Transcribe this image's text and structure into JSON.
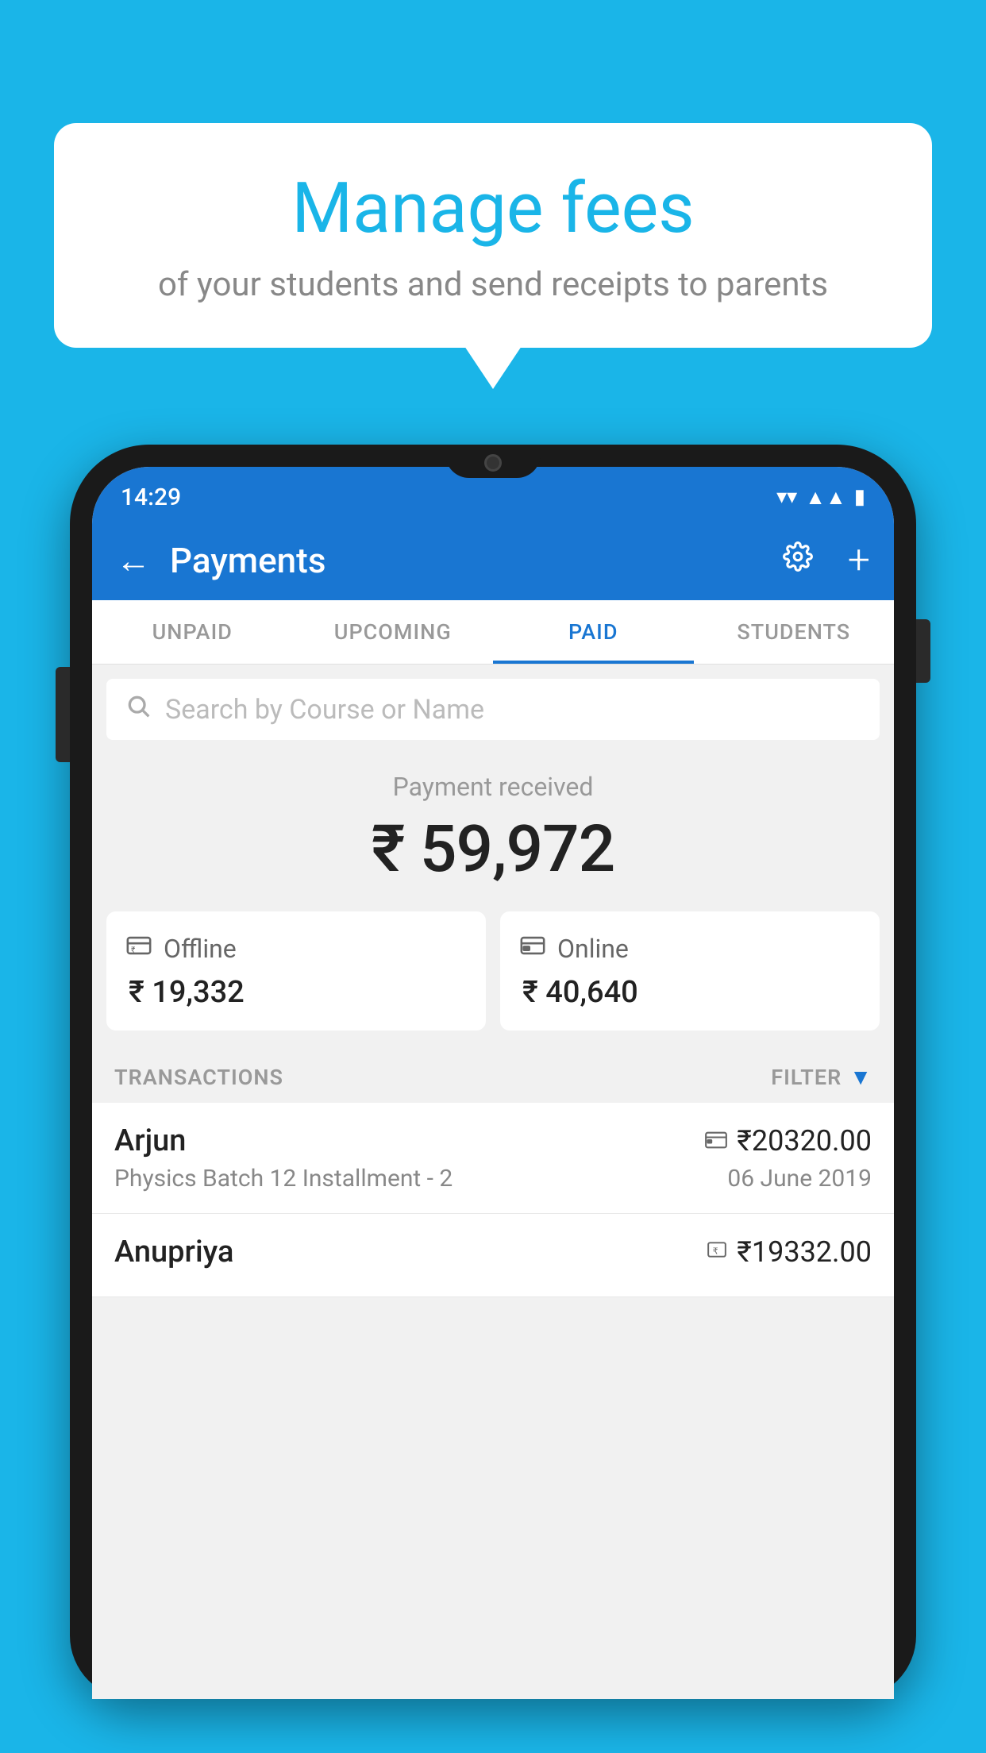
{
  "background_color": "#1ab5e8",
  "bubble": {
    "title": "Manage fees",
    "subtitle": "of your students and send receipts to parents"
  },
  "status_bar": {
    "time": "14:29",
    "icons": [
      "wifi",
      "signal",
      "battery"
    ]
  },
  "header": {
    "title": "Payments",
    "back_label": "←",
    "settings_label": "⚙",
    "plus_label": "+"
  },
  "tabs": [
    {
      "label": "UNPAID",
      "active": false
    },
    {
      "label": "UPCOMING",
      "active": false
    },
    {
      "label": "PAID",
      "active": true
    },
    {
      "label": "STUDENTS",
      "active": false
    }
  ],
  "search": {
    "placeholder": "Search by Course or Name"
  },
  "payment_summary": {
    "label": "Payment received",
    "total": "₹ 59,972",
    "offline": {
      "type": "Offline",
      "amount": "₹ 19,332",
      "icon": "rupee-card-icon"
    },
    "online": {
      "type": "Online",
      "amount": "₹ 40,640",
      "icon": "credit-card-icon"
    }
  },
  "transactions": {
    "section_label": "TRANSACTIONS",
    "filter_label": "FILTER",
    "rows": [
      {
        "name": "Arjun",
        "amount": "₹20320.00",
        "course": "Physics Batch 12 Installment - 2",
        "date": "06 June 2019",
        "payment_icon": "card"
      },
      {
        "name": "Anupriya",
        "amount": "₹19332.00",
        "course": "",
        "date": "",
        "payment_icon": "rupee"
      }
    ]
  }
}
